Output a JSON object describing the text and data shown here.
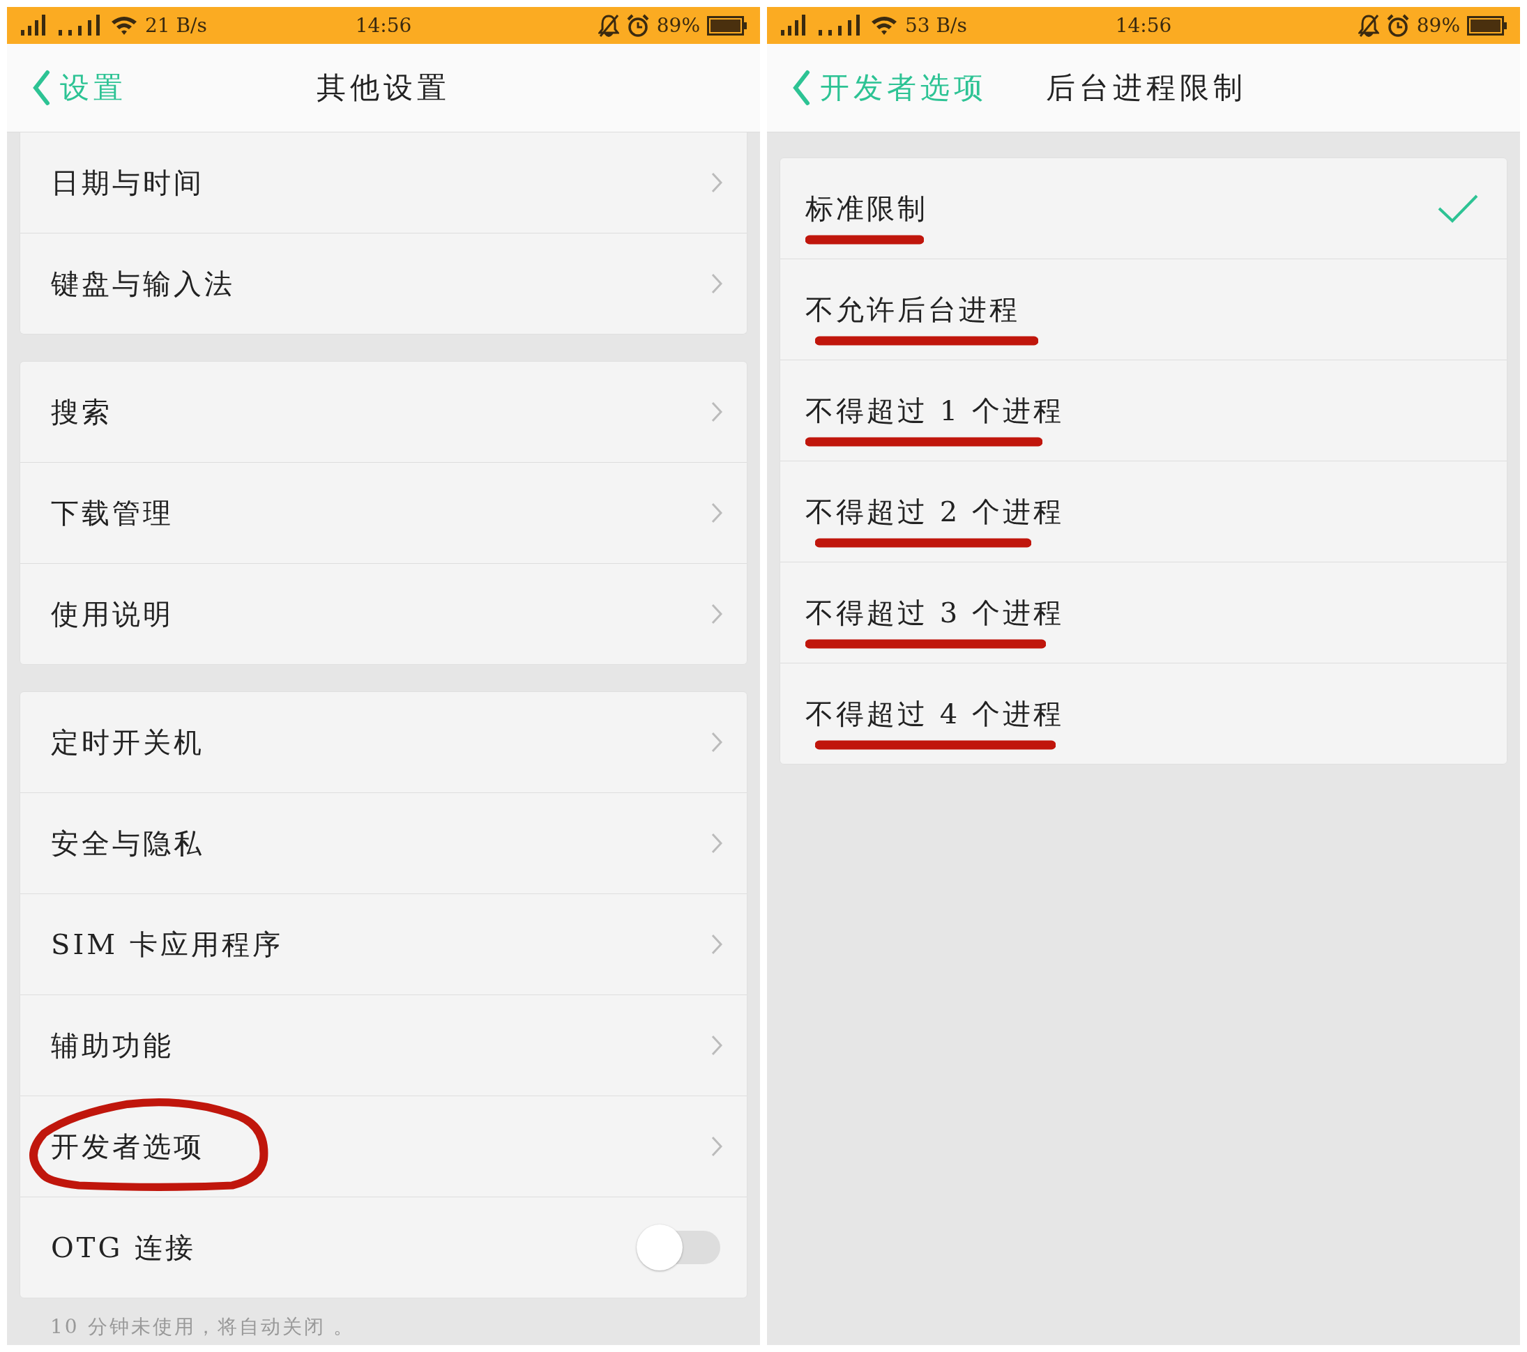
{
  "screens": [
    {
      "status_bar": {
        "speed": "21 B/s",
        "time": "14:56",
        "battery": "89%"
      },
      "header": {
        "back_label": "设置",
        "title": "其他设置"
      },
      "groups": [
        [
          {
            "kind": "link",
            "label": "日期与时间",
            "circled": false
          },
          {
            "kind": "link",
            "label": "键盘与输入法",
            "circled": false
          }
        ],
        [
          {
            "kind": "link",
            "label": "搜索",
            "circled": false
          },
          {
            "kind": "link",
            "label": "下载管理",
            "circled": false
          },
          {
            "kind": "link",
            "label": "使用说明",
            "circled": false
          }
        ],
        [
          {
            "kind": "link",
            "label": "定时开关机",
            "circled": false
          },
          {
            "kind": "link",
            "label": "安全与隐私",
            "circled": false
          },
          {
            "kind": "link",
            "label": "SIM 卡应用程序",
            "circled": false
          },
          {
            "kind": "link",
            "label": "辅助功能",
            "circled": false
          },
          {
            "kind": "link",
            "label": "开发者选项",
            "circled": true
          },
          {
            "kind": "toggle",
            "label": "OTG 连接",
            "on": false,
            "circled": false
          }
        ]
      ],
      "footnote": "10 分钟未使用，将自动关闭 。"
    },
    {
      "status_bar": {
        "speed": "53 B/s",
        "time": "14:56",
        "battery": "89%"
      },
      "header": {
        "back_label": "开发者选项",
        "title": "后台进程限制"
      },
      "options": [
        {
          "label": "标准限制",
          "selected": true,
          "underlined": true
        },
        {
          "label": "不允许后台进程",
          "selected": false,
          "underlined": true
        },
        {
          "label": "不得超过 1 个进程",
          "selected": false,
          "underlined": true
        },
        {
          "label": "不得超过 2 个进程",
          "selected": false,
          "underlined": true
        },
        {
          "label": "不得超过 3 个进程",
          "selected": false,
          "underlined": true
        },
        {
          "label": "不得超过 4 个进程",
          "selected": false,
          "underlined": true
        }
      ]
    }
  ]
}
